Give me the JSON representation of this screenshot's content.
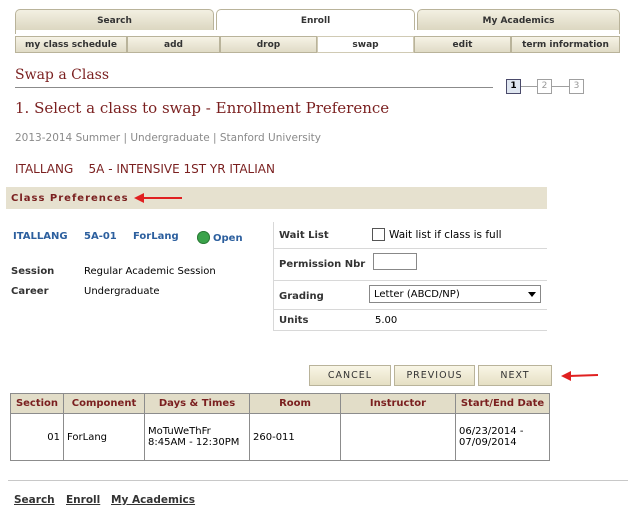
{
  "main_tabs": [
    {
      "label": "Search"
    },
    {
      "label": "Enroll"
    },
    {
      "label": "My Academics"
    }
  ],
  "sub_tabs": [
    {
      "label": "my class schedule"
    },
    {
      "label": "add"
    },
    {
      "label": "drop"
    },
    {
      "label": "swap"
    },
    {
      "label": "edit"
    },
    {
      "label": "term information"
    }
  ],
  "page_title": "Swap a Class",
  "steps": [
    "1",
    "2",
    "3"
  ],
  "step_heading": "1.  Select a class to swap - Enrollment Preference",
  "term_info": "2013-2014 Summer | Undergraduate | Stanford University",
  "course_title": "ITALLANG    5A - INTENSIVE 1ST YR ITALIAN",
  "section_header": "Class Preferences",
  "class_info": {
    "subject": "ITALLANG",
    "number": "5A-01",
    "component": "ForLang",
    "status": "Open",
    "status_color": "#3aa34a",
    "session_label": "Session",
    "session_value": "Regular Academic Session",
    "career_label": "Career",
    "career_value": "Undergraduate"
  },
  "preferences": {
    "waitlist_label": "Wait List",
    "waitlist_checkbox_label": "Wait list if class is full",
    "permission_label": "Permission Nbr",
    "permission_value": "",
    "grading_label": "Grading",
    "grading_value": "Letter (ABCD/NP)",
    "units_label": "Units",
    "units_value": "5.00"
  },
  "buttons": {
    "cancel": "CANCEL",
    "previous": "PREVIOUS",
    "next": "NEXT"
  },
  "table": {
    "headers": [
      "Section",
      "Component",
      "Days & Times",
      "Room",
      "Instructor",
      "Start/End Date"
    ],
    "row": {
      "section": "01",
      "component": "ForLang",
      "days_times": "MoTuWeThFr 8:45AM - 12:30PM",
      "room": "260-011",
      "instructor": "",
      "dates": "06/23/2014 - 07/09/2014"
    }
  },
  "footer_links": [
    "Search",
    "Enroll",
    "My Academics"
  ],
  "colors": {
    "accent": "#7a1f1f",
    "arrow": "#e02020",
    "link": "#2c5f9e"
  }
}
